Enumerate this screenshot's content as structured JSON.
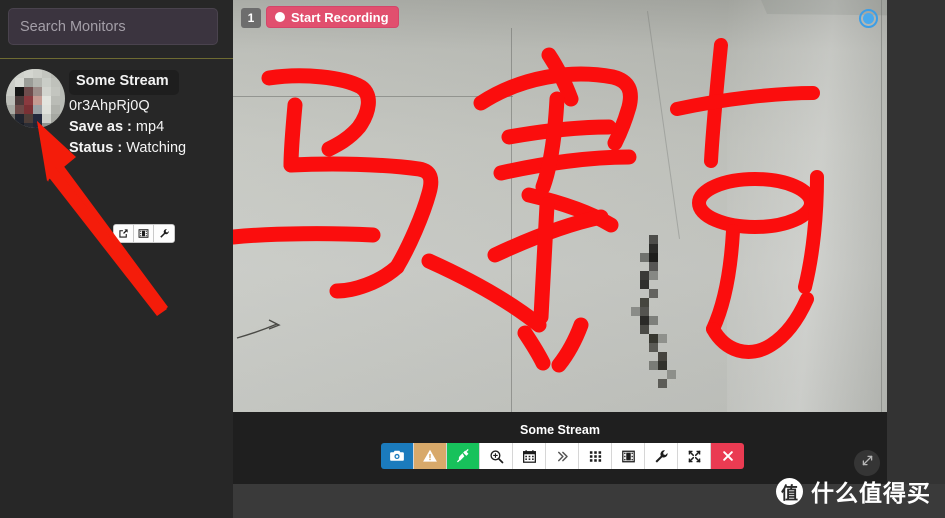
{
  "sidebar": {
    "search": {
      "placeholder": "Search Monitors",
      "value": ""
    },
    "monitor": {
      "title": "Some Stream",
      "id": "0r3AhpRj0Q",
      "save_as_label": "Save as :",
      "save_as_value": "mp4",
      "status_label": "Status :",
      "status_value": "Watching",
      "buttons": [
        {
          "name": "open-external",
          "icon": "external-link-icon"
        },
        {
          "name": "videos",
          "icon": "film-strip-icon"
        },
        {
          "name": "settings",
          "icon": "wrench-icon"
        }
      ]
    }
  },
  "video": {
    "camera_number": "1",
    "record_button_label": "Start Recording",
    "stream_title": "Some Stream",
    "live_indicator": "live-status-icon",
    "toolbar": [
      {
        "name": "snapshot",
        "icon": "camera-icon",
        "color": "#1b7bbd",
        "label": "Snapshot"
      },
      {
        "name": "detector",
        "icon": "warning-triangle-icon",
        "color": "#d8a96a",
        "label": "Detector"
      },
      {
        "name": "connection",
        "icon": "plug-icon",
        "color": "#17c25b",
        "label": "Connection"
      },
      {
        "name": "zoom",
        "icon": "magnifier-plus-icon",
        "color": "#ffffff",
        "label": "Zoom"
      },
      {
        "name": "calendar",
        "icon": "calendar-icon",
        "color": "#ffffff",
        "label": "Calendar"
      },
      {
        "name": "more",
        "icon": "chevron-double-right-icon",
        "color": "#ffffff",
        "label": "More"
      },
      {
        "name": "grid",
        "icon": "grid-icon",
        "color": "#ffffff",
        "label": "Grid"
      },
      {
        "name": "videos",
        "icon": "film-strip-icon",
        "color": "#ffffff",
        "label": "Videos"
      },
      {
        "name": "settings",
        "icon": "wrench-icon",
        "color": "#ffffff",
        "label": "Settings"
      },
      {
        "name": "fullscreen",
        "icon": "expand-arrows-icon",
        "color": "#ffffff",
        "label": "Fullscreen"
      },
      {
        "name": "close",
        "icon": "close-x-icon",
        "color": "#ea3b52",
        "label": "Close"
      }
    ]
  },
  "watermark": {
    "logo_char": "值",
    "text": "什么值得买"
  },
  "colors": {
    "accent_record": "#e14f6e",
    "accent_blue": "#1b7bbd",
    "accent_green": "#17c25b",
    "accent_gold": "#d8a96a",
    "accent_red": "#ea3b52",
    "sidebar_bg": "#272727",
    "panel_bg": "#1f1f1f",
    "divider": "#6e6b32",
    "annotation_arrow": "#f41c0a"
  }
}
